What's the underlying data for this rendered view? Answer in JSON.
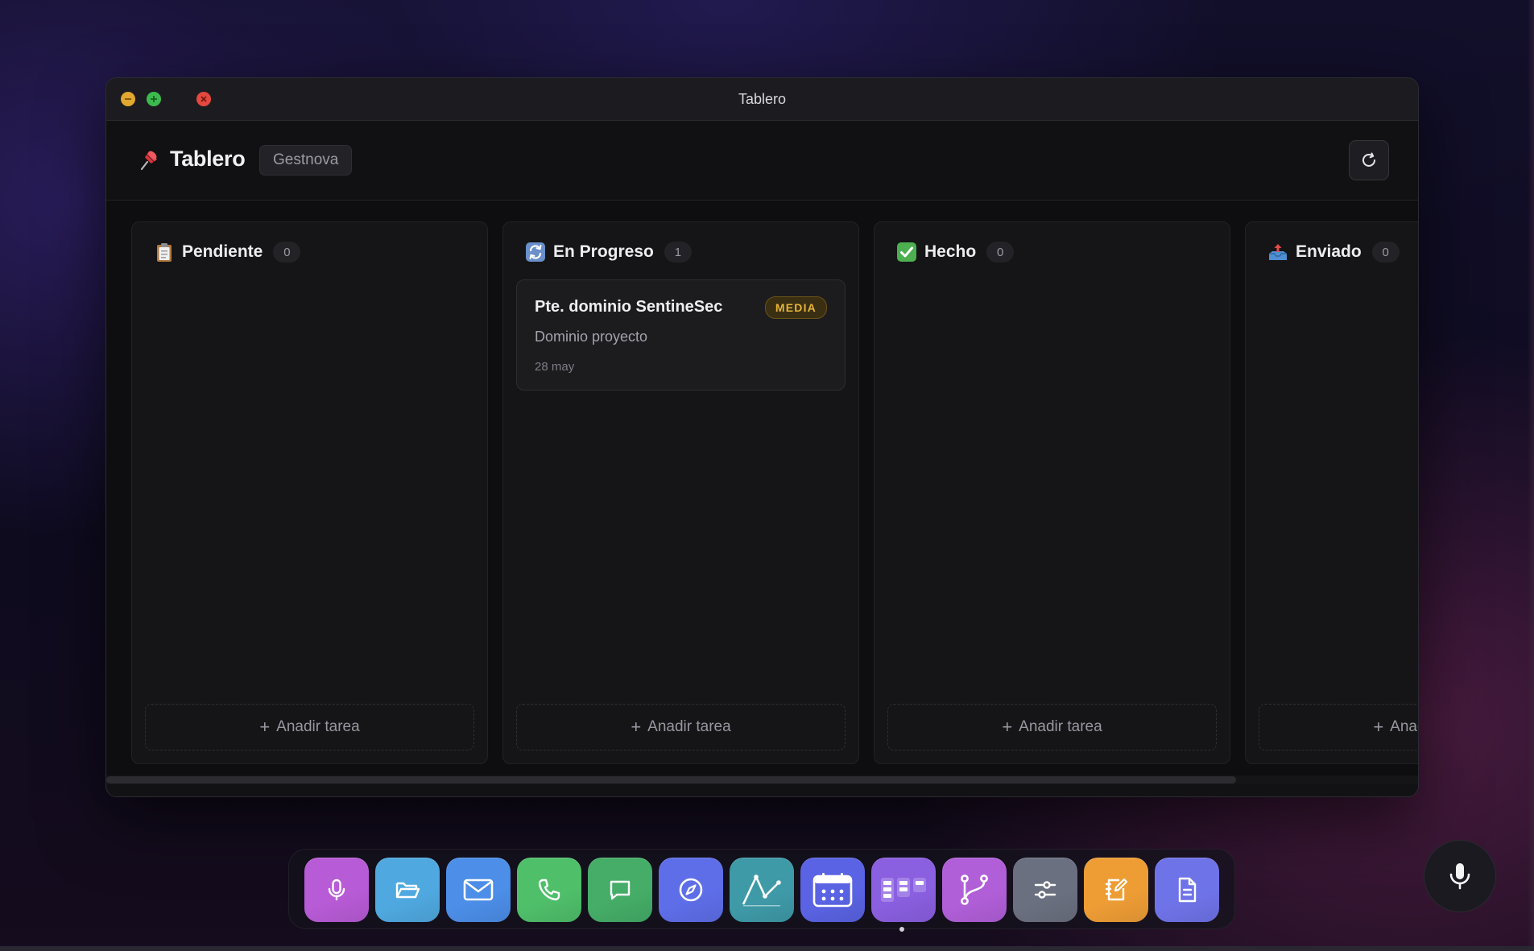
{
  "window": {
    "title": "Tablero"
  },
  "header": {
    "title": "Tablero",
    "project": "Gestnova",
    "icon": "pushpin-icon"
  },
  "columns": [
    {
      "title": "Pendiente",
      "count": "0",
      "icon": "clipboard-icon",
      "add_label": "Anadir tarea"
    },
    {
      "title": "En Progreso",
      "count": "1",
      "icon": "repeat-arrows-icon",
      "add_label": "Anadir tarea",
      "cards": [
        {
          "title": "Pte. dominio SentineSec",
          "priority": "MEDIA",
          "description": "Dominio proyecto",
          "date": "28 may"
        }
      ]
    },
    {
      "title": "Hecho",
      "count": "0",
      "icon": "check-mark-icon",
      "add_label": "Anadir tarea"
    },
    {
      "title": "Enviado",
      "count": "0",
      "icon": "outbox-tray-icon",
      "add_label": "Anadir tarea"
    }
  ],
  "dock": {
    "apps": [
      {
        "name": "microphone-app",
        "color": "#b85bd6"
      },
      {
        "name": "files-app",
        "color": "#4fa9e0"
      },
      {
        "name": "mail-app",
        "color": "#4c8ee8"
      },
      {
        "name": "phone-app",
        "color": "#4fbf6a"
      },
      {
        "name": "messages-app",
        "color": "#45ad67"
      },
      {
        "name": "browser-app",
        "color": "#5e6ee8"
      },
      {
        "name": "analytics-app",
        "color": "#3f9aa8"
      },
      {
        "name": "calendar-app",
        "color": "#5a63e3"
      },
      {
        "name": "board-app",
        "color": "#8a5fe0"
      },
      {
        "name": "git-app",
        "color": "#b15fd8"
      },
      {
        "name": "settings-app",
        "color": "#6b7080"
      },
      {
        "name": "notes-app",
        "color": "#ee9d35"
      },
      {
        "name": "documents-app",
        "color": "#6f73e8"
      }
    ],
    "active_app": "board-app"
  },
  "colors": {
    "priority_media": "#e6b43a",
    "background": "#0e0b1f",
    "window": "#121214"
  }
}
